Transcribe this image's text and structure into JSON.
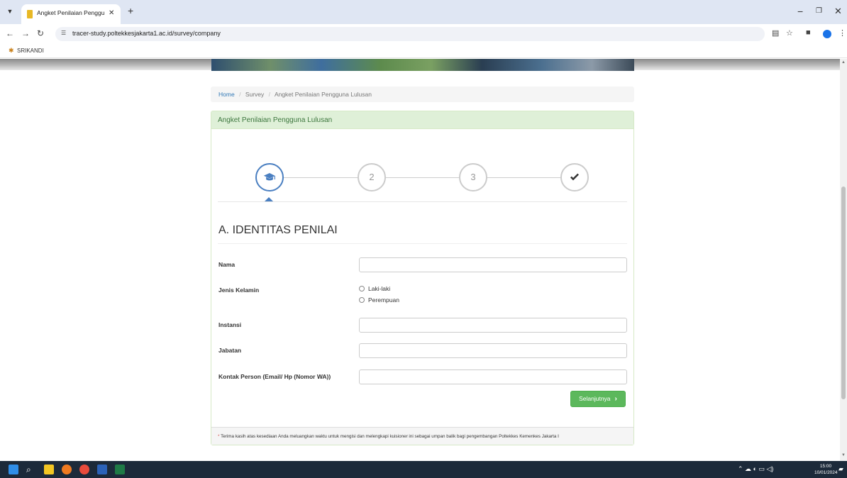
{
  "browser": {
    "tab_title": "Angket Penilaian Pengguna Lul",
    "url": "tracer-study.poltekkesjakarta1.ac.id/survey/company",
    "bookmark": "SRIKANDI"
  },
  "breadcrumb": {
    "home": "Home",
    "items": [
      "Survey",
      "Angket Penilaian Pengguna Lulusan"
    ]
  },
  "panel": {
    "heading": "Angket Penilaian Pengguna Lulusan",
    "steps": [
      "graduation-cap-icon",
      "2",
      "3",
      "check-icon"
    ],
    "section_title": "A. IDENTITAS PENILAI",
    "fields": {
      "nama": "Nama",
      "jenis_kelamin": "Jenis Kelamin",
      "laki": "Laki-laki",
      "perempuan": "Perempuan",
      "instansi": "Instansi",
      "jabatan": "Jabatan",
      "kontak": "Kontak Person (Email/ Hp (Nomor WA))"
    },
    "next_button": "Selanjutnya",
    "footer": "Terima kasih atas kesediaan Anda meluangkan waktu untuk mengisi dan melengkapi kuisioner ini sebagai umpan balik bagi pengembangan Poltekkes Kemenkes Jakarta I"
  },
  "taskbar": {
    "time": "15:00",
    "date": "10/01/2024"
  },
  "colors": {
    "panel_heading_bg": "#dff0d8",
    "panel_heading_text": "#3c763d",
    "active_step": "#4a7fc1",
    "next_button": "#5cb85c",
    "link": "#337ab7"
  }
}
